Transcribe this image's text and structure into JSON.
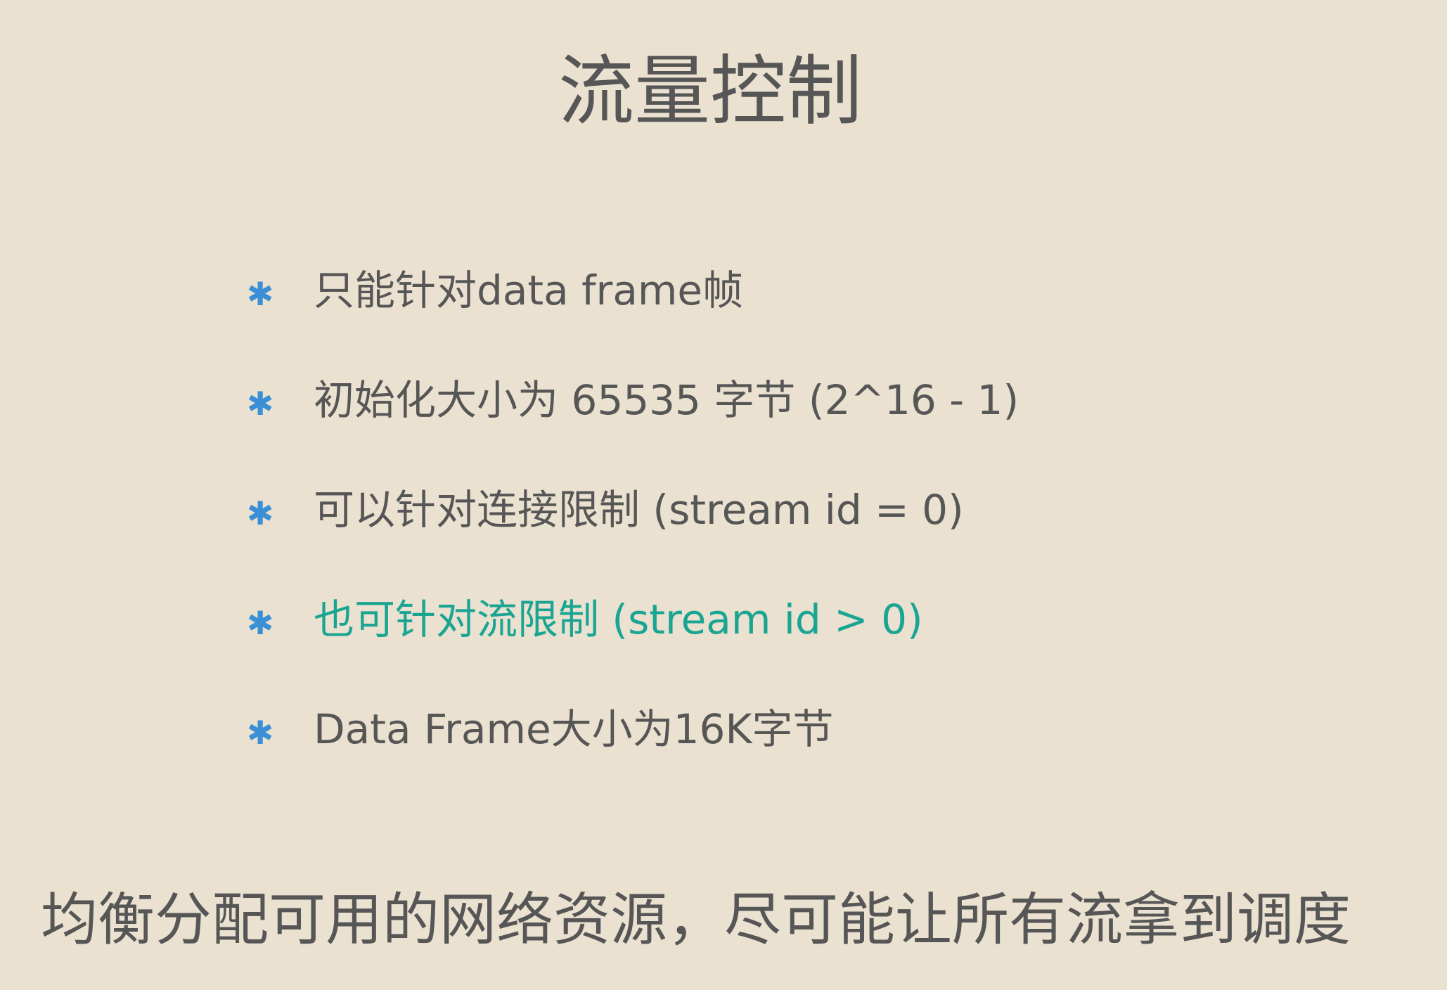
{
  "title": "流量控制",
  "bullet_icon": "asterisk-icon",
  "bullet_glyph": "✱",
  "bullets": [
    {
      "text": "只能针对data frame帧",
      "highlighted": false
    },
    {
      "text": "初始化大小为 65535 字节 (2^16 - 1)",
      "highlighted": false
    },
    {
      "text": "可以针对连接限制 (stream id = 0)",
      "highlighted": false
    },
    {
      "text": "也可针对流限制 (stream id > 0)",
      "highlighted": true
    },
    {
      "text": "Data Frame大小为16K字节",
      "highlighted": false
    }
  ],
  "footer": "均衡分配可用的网络资源，尽可能让所有流拿到调度",
  "colors": {
    "background": "#EAE1D0",
    "text": "#565656",
    "bullet": "#3A8FD6",
    "highlight": "#1AA592"
  }
}
